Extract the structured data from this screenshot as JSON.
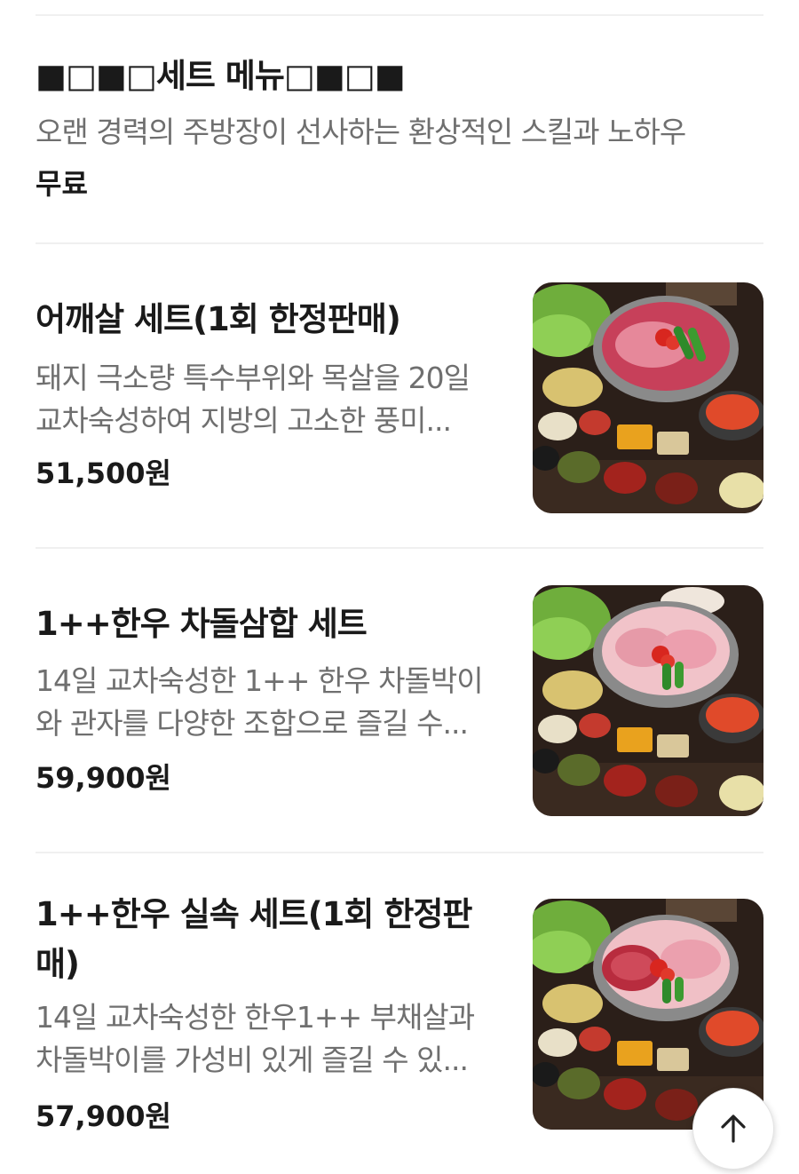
{
  "section": {
    "title": "■□■□세트 메뉴□■□■",
    "description": "오랜 경력의 주방장이 선사하는 환상적인 스킬과 노하우",
    "price": "무료"
  },
  "menu_items": [
    {
      "name": "어깨살 세트(1회 한정판매)",
      "description": "돼지 극소량 특수부위와 목살을 20일 교차숙성하여 지방의 고소한 풍미...",
      "price": "51,500원",
      "image_icon": "pork-bbq-set-photo"
    },
    {
      "name": "1++한우 차돌삼합 세트",
      "description": "14일 교차숙성한 1++ 한우 차돌박이와 관자를 다양한 조합으로 즐길 수...",
      "price": "59,900원",
      "image_icon": "beef-brisket-set-photo"
    },
    {
      "name": "1++한우 실속 세트(1회 한정판매)",
      "description": "14일 교차숙성한 한우1++ 부채살과 차돌박이를 가성비 있게 즐길 수 있...",
      "price": "57,900원",
      "image_icon": "beef-value-set-photo"
    }
  ],
  "scroll_top_icon": "arrow-up-icon"
}
